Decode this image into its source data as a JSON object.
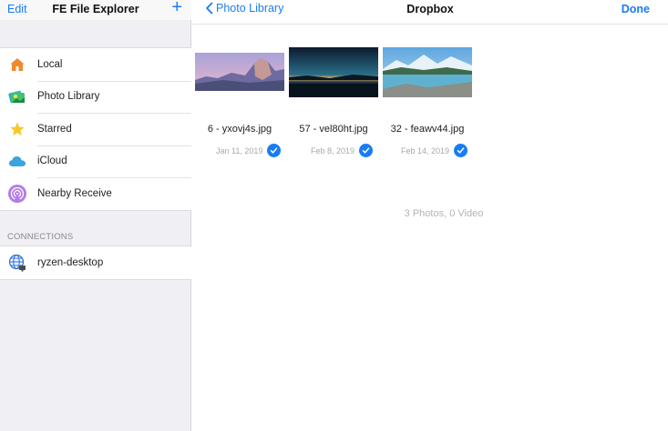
{
  "sidebar": {
    "edit_label": "Edit",
    "title": "FE File Explorer",
    "add_label": "+",
    "items": [
      {
        "label": "Local",
        "icon": "house-icon"
      },
      {
        "label": "Photo Library",
        "icon": "photos-icon"
      },
      {
        "label": "Starred",
        "icon": "star-icon"
      },
      {
        "label": "iCloud",
        "icon": "cloud-icon"
      },
      {
        "label": "Nearby Receive",
        "icon": "airdrop-icon"
      }
    ],
    "connections_header": "CONNECTIONS",
    "connections": [
      {
        "label": "ryzen-desktop",
        "icon": "globe-icon"
      }
    ]
  },
  "main": {
    "back_label": "Photo Library",
    "title": "Dropbox",
    "done_label": "Done",
    "photos": [
      {
        "name": "6 - yxovj4s.jpg",
        "date": "Jan 11, 2019",
        "selected": true
      },
      {
        "name": "57 - vel80ht.jpg",
        "date": "Feb 8, 2019",
        "selected": true
      },
      {
        "name": "32 - feawv44.jpg",
        "date": "Feb 14, 2019",
        "selected": true
      }
    ],
    "summary": "3 Photos, 0 Video"
  },
  "colors": {
    "accent": "#1a7cf5",
    "sidebar_bg": "#efeff4"
  }
}
